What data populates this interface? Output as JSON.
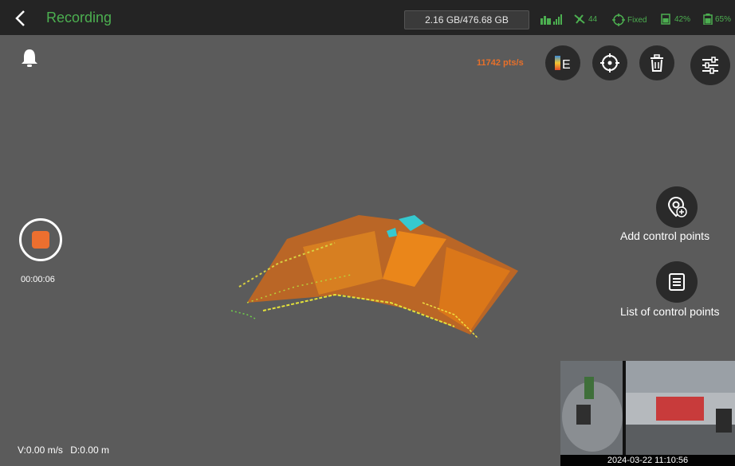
{
  "header": {
    "title": "Recording",
    "storage": "2.16 GB/476.68 GB",
    "satellites": "44",
    "fix_status": "Fixed",
    "device_battery": "42%",
    "controller_battery": "65%"
  },
  "toolbar": {
    "points_rate": "11742 pts/s",
    "color_mode_icon": "colorbar-E-icon",
    "locate_icon": "crosshair-icon",
    "delete_icon": "trash-icon",
    "settings_icon": "sliders-icon"
  },
  "recording": {
    "elapsed": "00:00:06",
    "velocity": "V:0.00 m/s",
    "distance": "D:0.00 m"
  },
  "side_actions": {
    "add_control_points": "Add control points",
    "list_control_points": "List of control points"
  },
  "camera": {
    "timestamp": "2024-03-22 11:10:56"
  },
  "colors": {
    "accent_green": "#4caf50",
    "record_orange": "#ec6f2f",
    "rate_orange": "#e8702a",
    "background": "#5b5b5b"
  }
}
